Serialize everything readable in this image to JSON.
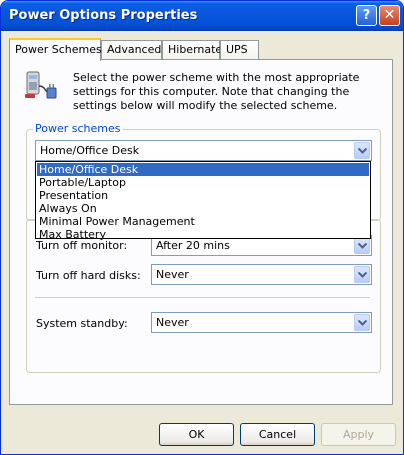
{
  "window": {
    "title": "Power Options Properties",
    "help_glyph": "?",
    "close_glyph": "✕"
  },
  "tabs": [
    {
      "label": "Power Schemes",
      "active": true
    },
    {
      "label": "Advanced",
      "active": false
    },
    {
      "label": "Hibernate",
      "active": false
    },
    {
      "label": "UPS",
      "active": false
    }
  ],
  "intro_text": "Select the power scheme with the most appropriate settings for this computer. Note that changing the settings below will modify the selected scheme.",
  "power_schemes": {
    "group_label": "Power schemes",
    "selected": "Home/Office Desk",
    "options": [
      "Home/Office Desk",
      "Portable/Laptop",
      "Presentation",
      "Always On",
      "Minimal Power Management",
      "Max Battery"
    ]
  },
  "settings": {
    "monitor": {
      "label": "Turn off monitor:",
      "value": "After 20 mins"
    },
    "hard_disks": {
      "label": "Turn off hard disks:",
      "value": "Never"
    },
    "standby": {
      "label": "System standby:",
      "value": "Never"
    }
  },
  "buttons": {
    "ok": "OK",
    "cancel": "Cancel",
    "apply": "Apply"
  },
  "colors": {
    "title_bar": "#0856dc",
    "selection": "#316ac5",
    "group_label": "#0046d5"
  }
}
